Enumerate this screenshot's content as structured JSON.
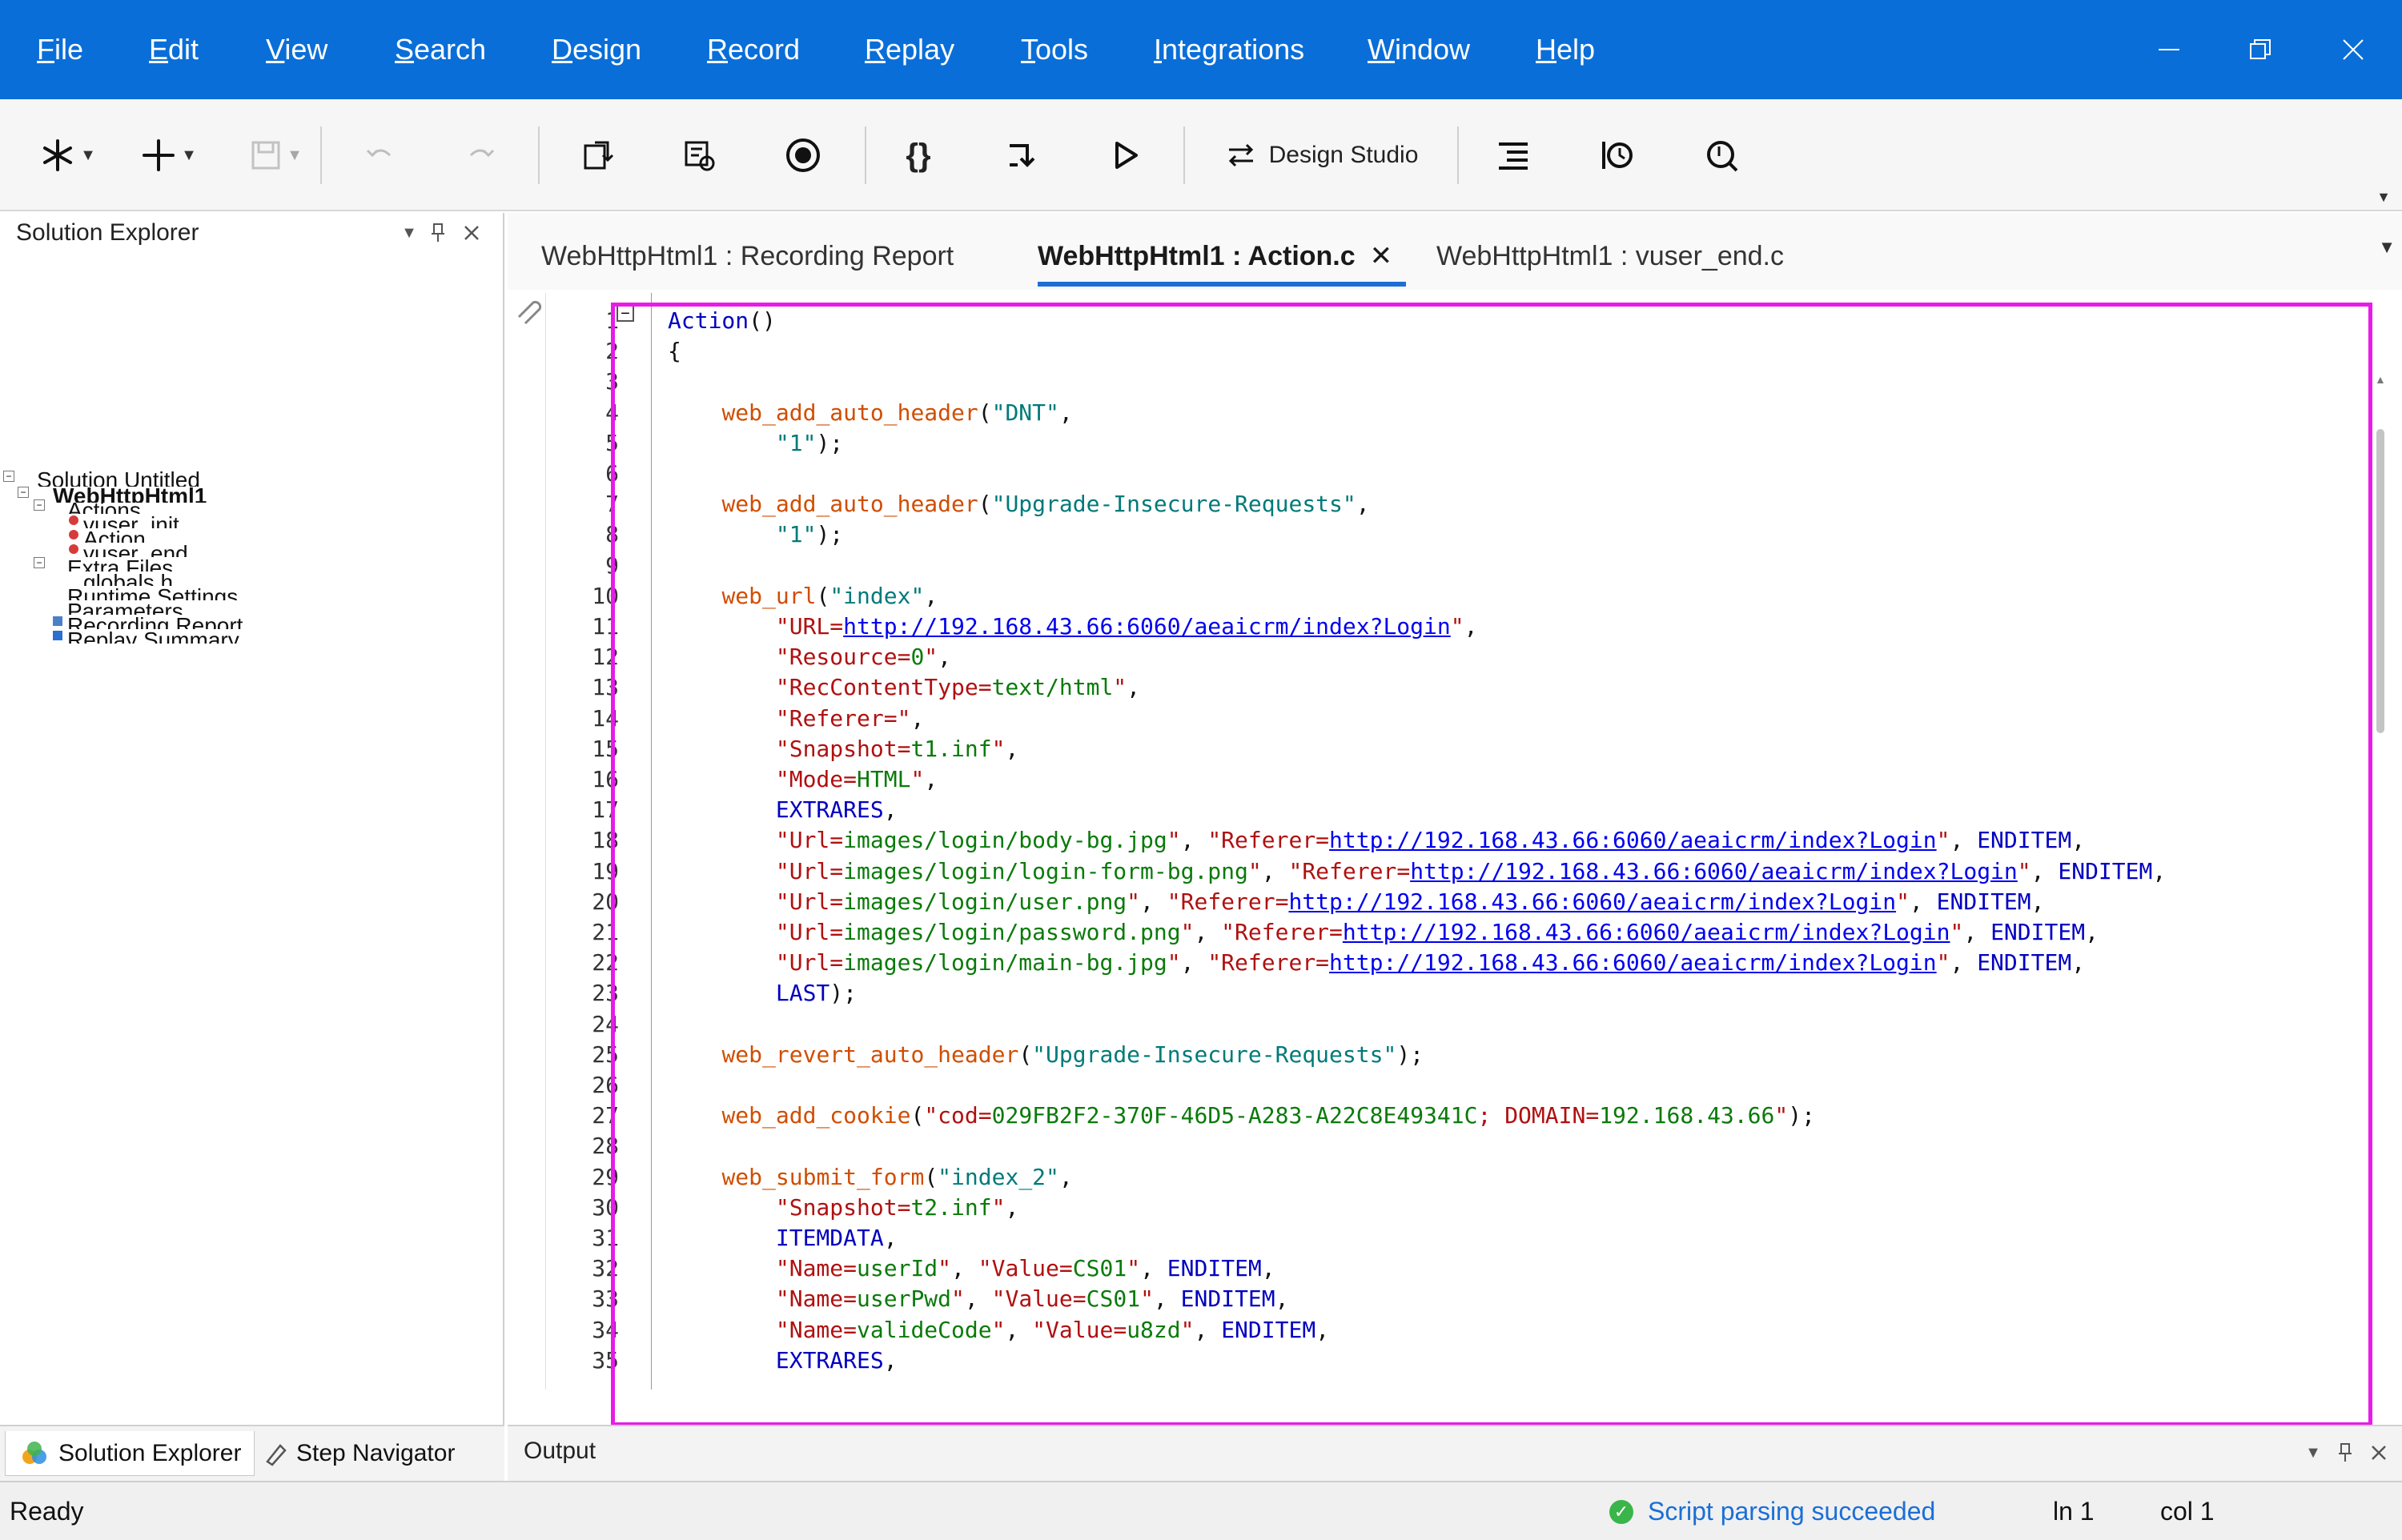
{
  "menu": [
    "File",
    "Edit",
    "View",
    "Search",
    "Design",
    "Record",
    "Replay",
    "Tools",
    "Integrations",
    "Window",
    "Help"
  ],
  "toolbar": {
    "design_studio_label": "Design Studio"
  },
  "solution_explorer": {
    "title": "Solution Explorer",
    "tree": [
      "Solution Untitled",
      "WebHttpHtml1",
      "Actions",
      "vuser_init",
      "Action",
      "vuser_end",
      "Extra Files",
      "globals.h",
      "Runtime Settings",
      "Parameters",
      "Recording Report",
      "Replay Summary"
    ],
    "bottom_tabs": [
      "Solution Explorer",
      "Step Navigator"
    ]
  },
  "tabs": [
    {
      "label": "WebHttpHtml1 : Recording Report"
    },
    {
      "label": "WebHttpHtml1 : Action.c",
      "active": true
    },
    {
      "label": "WebHttpHtml1 : vuser_end.c"
    }
  ],
  "editor": {
    "line_numbers": [
      "1",
      "2",
      "3",
      "4",
      "5",
      "6",
      "7",
      "8",
      "9",
      "10",
      "11",
      "12",
      "13",
      "14",
      "15",
      "16",
      "17",
      "18",
      "19",
      "20",
      "21",
      "22",
      "23",
      "24",
      "25",
      "26",
      "27",
      "28",
      "29",
      "30",
      "31",
      "32",
      "33",
      "34",
      "35"
    ],
    "lines": [
      "Action()",
      "{",
      "",
      "    web_add_auto_header(\"DNT\",",
      "        \"1\");",
      "",
      "    web_add_auto_header(\"Upgrade-Insecure-Requests\",",
      "        \"1\");",
      "",
      "    web_url(\"index\",",
      "        \"URL=http://192.168.43.66:6060/aeaicrm/index?Login\",",
      "        \"Resource=0\",",
      "        \"RecContentType=text/html\",",
      "        \"Referer=\",",
      "        \"Snapshot=t1.inf\",",
      "        \"Mode=HTML\",",
      "        EXTRARES,",
      "        \"Url=images/login/body-bg.jpg\", \"Referer=http://192.168.43.66:6060/aeaicrm/index?Login\", ENDITEM,",
      "        \"Url=images/login/login-form-bg.png\", \"Referer=http://192.168.43.66:6060/aeaicrm/index?Login\", ENDITEM,",
      "        \"Url=images/login/user.png\", \"Referer=http://192.168.43.66:6060/aeaicrm/index?Login\", ENDITEM,",
      "        \"Url=images/login/password.png\", \"Referer=http://192.168.43.66:6060/aeaicrm/index?Login\", ENDITEM,",
      "        \"Url=images/login/main-bg.jpg\", \"Referer=http://192.168.43.66:6060/aeaicrm/index?Login\", ENDITEM,",
      "        LAST);",
      "",
      "    web_revert_auto_header(\"Upgrade-Insecure-Requests\");",
      "",
      "    web_add_cookie(\"cod=029FB2F2-370F-46D5-A283-A22C8E49341C; DOMAIN=192.168.43.66\");",
      "",
      "    web_submit_form(\"index_2\",",
      "        \"Snapshot=t2.inf\",",
      "        ITEMDATA,",
      "        \"Name=userId\", \"Value=CS01\", ENDITEM,",
      "        \"Name=userPwd\", \"Value=CS01\", ENDITEM,",
      "        \"Name=valideCode\", \"Value=u8zd\", ENDITEM,",
      "        EXTRARES,"
    ]
  },
  "output": {
    "title": "Output"
  },
  "status": {
    "ready": "Ready",
    "message": "Script parsing succeeded",
    "ln": "ln 1",
    "col": "col 1"
  },
  "colors": {
    "menubar": "#0a6ed8",
    "accent": "#1d6fd6",
    "highlight_box": "#e81be8",
    "keyword": "#0000c0",
    "function": "#d14d00",
    "string": "#007a7a",
    "link": "#0000ee"
  }
}
